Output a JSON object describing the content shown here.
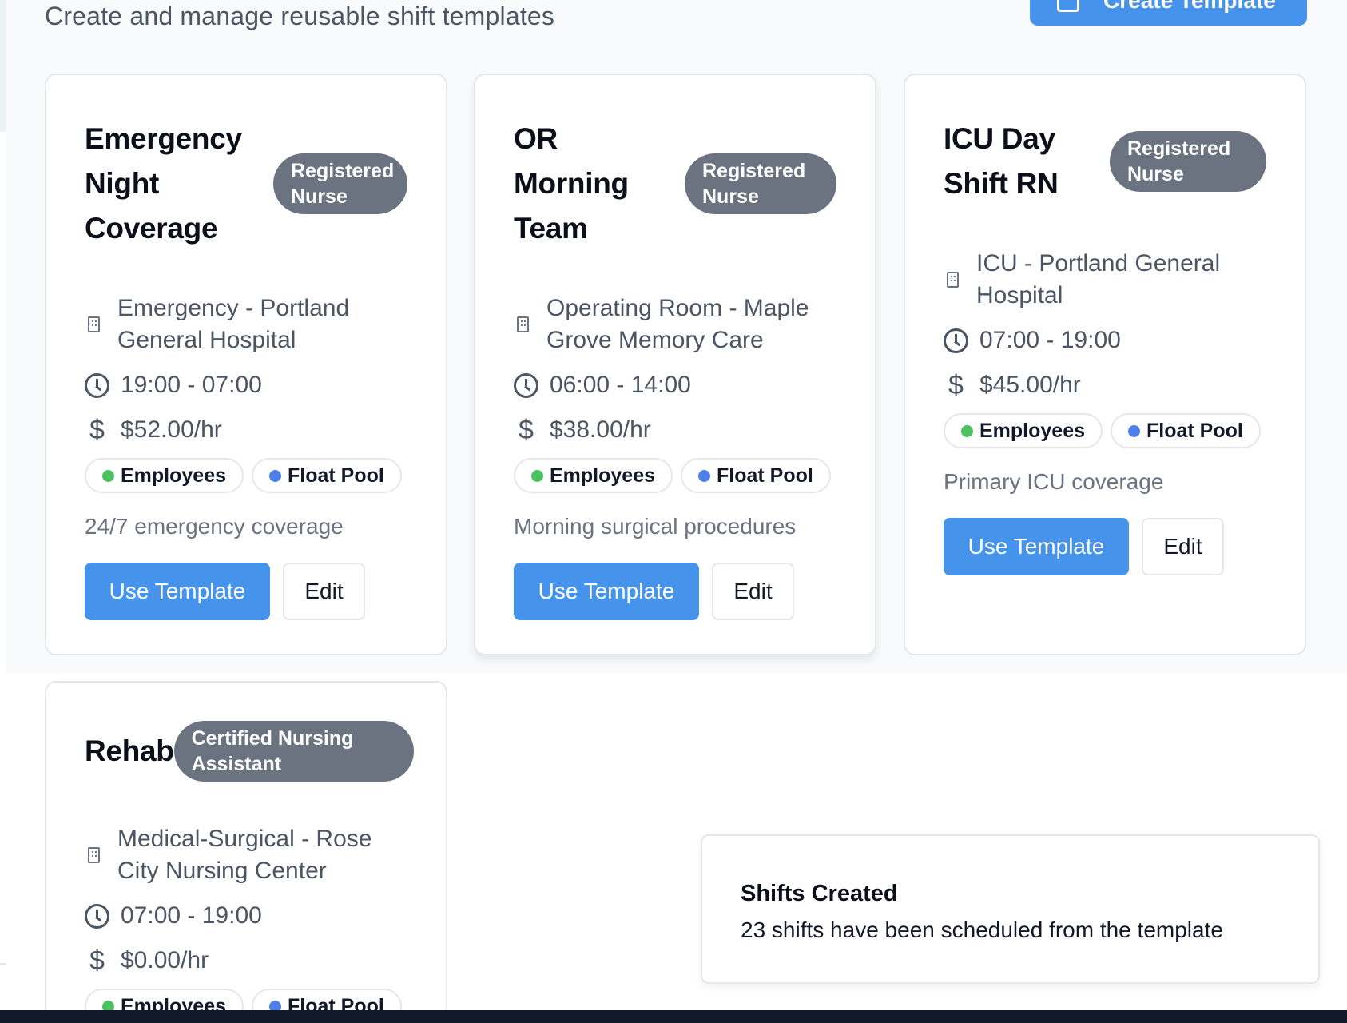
{
  "header": {
    "subtitle": "Create and manage reusable shift templates",
    "create_button_label": "Create Template"
  },
  "templates": [
    {
      "title": "Emergency Night Coverage",
      "role": "Registered Nurse",
      "location": "Emergency - Portland General Hospital",
      "hours": "19:00 - 07:00",
      "rate": "$52.00/hr",
      "audiences": [
        "Employees",
        "Float Pool"
      ],
      "description": "24/7 emergency coverage",
      "use_label": "Use Template",
      "edit_label": "Edit"
    },
    {
      "title": "OR Morning Team",
      "role": "Registered Nurse",
      "location": "Operating Room - Maple Grove Memory Care",
      "hours": "06:00 - 14:00",
      "rate": "$38.00/hr",
      "audiences": [
        "Employees",
        "Float Pool"
      ],
      "description": "Morning surgical procedures",
      "use_label": "Use Template",
      "edit_label": "Edit"
    },
    {
      "title": "ICU Day Shift RN",
      "role": "Registered Nurse",
      "location": "ICU - Portland General Hospital",
      "hours": "07:00 - 19:00",
      "rate": "$45.00/hr",
      "audiences": [
        "Employees",
        "Float Pool"
      ],
      "description": "Primary ICU coverage",
      "use_label": "Use Template",
      "edit_label": "Edit"
    },
    {
      "title": "Rehab",
      "role": "Certified Nursing Assistant",
      "location": "Medical-Surgical - Rose City Nursing Center",
      "hours": "07:00 - 19:00",
      "rate": "$0.00/hr",
      "audiences": [
        "Employees",
        "Float Pool"
      ]
    }
  ],
  "toast": {
    "title": "Shifts Created",
    "message": "23 shifts have been scheduled from the template"
  },
  "colors": {
    "primary": "#4593ea",
    "badge": "#6b7280",
    "employees_dot": "#4cc160",
    "float_pool_dot": "#4d80e8"
  }
}
